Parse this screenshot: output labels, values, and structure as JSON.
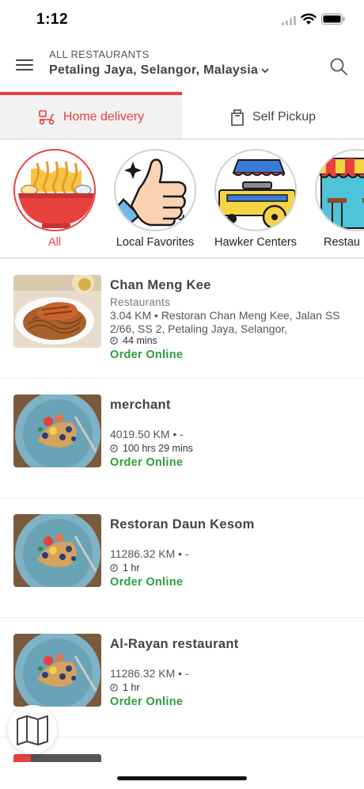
{
  "status": {
    "time": "1:12"
  },
  "header": {
    "caption": "ALL RESTAURANTS",
    "location": "Petaling Jaya, Selangor, Malaysia",
    "menu_icon": "hamburger-menu-icon",
    "search_icon": "search-icon"
  },
  "tabs": [
    {
      "label": "Home delivery",
      "icon": "delivery-scooter-icon",
      "active": true
    },
    {
      "label": "Self Pickup",
      "icon": "shopping-bag-icon",
      "active": false
    }
  ],
  "categories": [
    {
      "label": "All",
      "icon": "noodle-bowl-icon",
      "active": true
    },
    {
      "label": "Local Favorites",
      "icon": "thumbs-up-icon"
    },
    {
      "label": "Hawker Centers",
      "icon": "food-cart-icon"
    },
    {
      "label": "Restau",
      "icon": "restaurant-awning-icon"
    }
  ],
  "restaurants": [
    {
      "name": "Chan Meng Kee",
      "type": "Restaurants",
      "distance": "3.04 KM • Restoran Chan Meng Kee, Jalan SS 2/66, SS 2, Petaling Jaya, Selangor,",
      "time": "44 mins",
      "order": "Order Online"
    },
    {
      "name": "merchant",
      "distance": "4019.50 KM • -",
      "time": "100 hrs 29 mins",
      "order": "Order Online"
    },
    {
      "name": "Restoran Daun Kesom",
      "distance": "11286.32 KM • -",
      "time": "1 hr",
      "order": "Order Online"
    },
    {
      "name": "Al-Rayan restaurant",
      "distance": "11286.32 KM • -",
      "time": "1 hr",
      "order": "Order Online"
    }
  ],
  "colors": {
    "accent": "#e8403d",
    "order": "#2e9e3e"
  }
}
